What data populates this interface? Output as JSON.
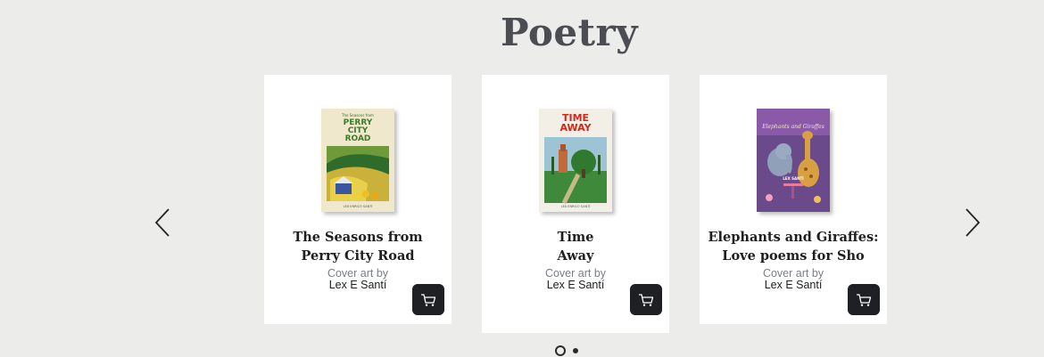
{
  "section": {
    "title": "Poetry"
  },
  "books": [
    {
      "title_line1": "The Seasons from",
      "title_line2": "Perry City Road",
      "credit_label": "Cover art by",
      "credit_name": "Lex E Santí",
      "cover_text": "PERRY CITY ROAD",
      "cover_author": "LEX ENRICO SANTÍ"
    },
    {
      "title_line1": "Time",
      "title_line2": "Away",
      "credit_label": "Cover art by",
      "credit_name": "Lex E Santí",
      "cover_text": "TIME AWAY",
      "cover_author": "LEX ENRICO SANTÍ"
    },
    {
      "title_line1": "Elephants and Giraffes:",
      "title_line2": "Love poems for Sho",
      "credit_label": "Cover art by",
      "credit_name": "Lex E Santí",
      "cover_text": "Elephants and Giraffes",
      "cover_author": "LEX SANTÍ"
    }
  ],
  "carousel": {
    "prev_icon": "chevron-left-icon",
    "next_icon": "chevron-right-icon",
    "pages": 2,
    "active_page": 1
  },
  "colors": {
    "background": "#ecedeb",
    "title": "#4b4d52",
    "cart_button": "#1f2023",
    "credit_label": "#7a7d88"
  }
}
